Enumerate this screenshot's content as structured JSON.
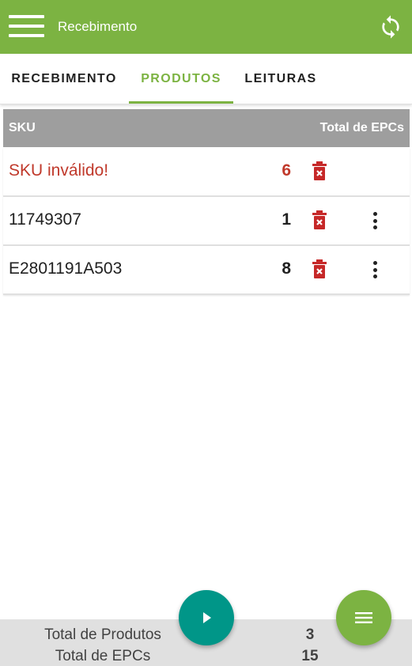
{
  "appbar": {
    "title": "Recebimento",
    "menu_icon": "hamburger-icon",
    "sync_icon": "sync-icon",
    "color": "#7cb342"
  },
  "tabs": [
    {
      "label": "RECEBIMENTO",
      "active": false
    },
    {
      "label": "PRODUTOS",
      "active": true
    },
    {
      "label": "LEITURAS",
      "active": false
    }
  ],
  "table": {
    "headers": {
      "sku": "SKU",
      "epcs": "Total de EPCs"
    },
    "rows": [
      {
        "sku": "SKU inválido!",
        "count": "6",
        "invalid": true
      },
      {
        "sku": "11749307",
        "count": "1",
        "invalid": false
      },
      {
        "sku": "E2801191A503",
        "count": "8",
        "invalid": false
      }
    ]
  },
  "footer": {
    "total_produtos_label": "Total de Produtos",
    "total_produtos_value": "3",
    "total_epcs_label": "Total de EPCs",
    "total_epcs_value": "15"
  },
  "fabs": {
    "play_icon": "play-icon",
    "menu_icon": "list-icon",
    "play_color": "#009688",
    "menu_color": "#7cb342"
  },
  "colors": {
    "accent": "#7cb342",
    "error": "#c0392b",
    "header_bg": "#9e9e9e"
  }
}
